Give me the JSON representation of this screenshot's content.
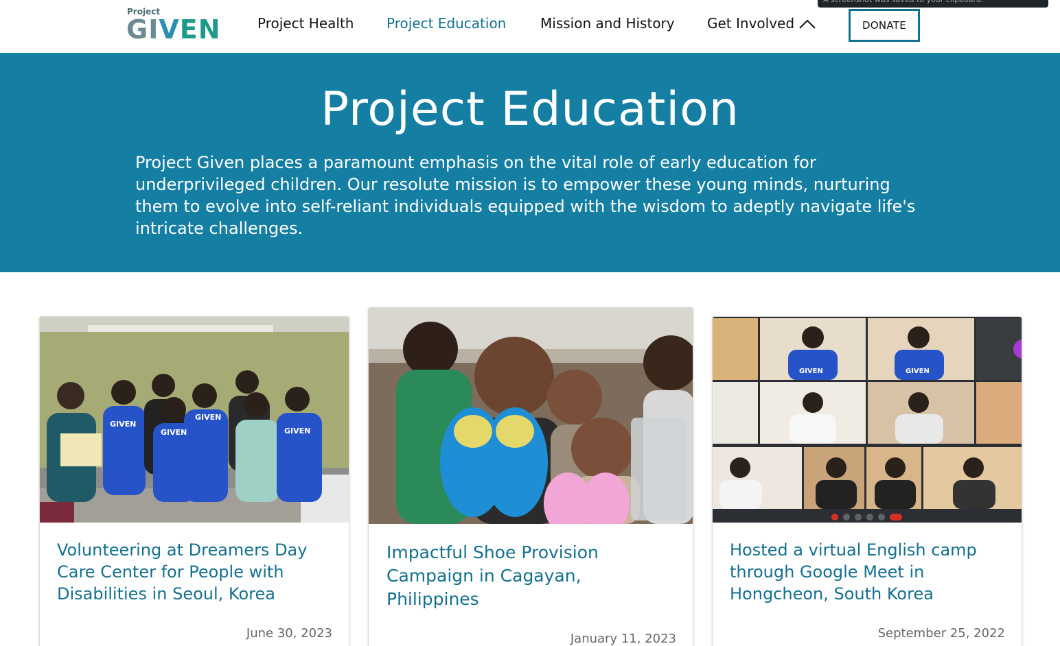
{
  "toast": {
    "text": "A screenshot was saved to your clipboard."
  },
  "logo": {
    "small": "Project",
    "big_a": "GI",
    "big_b": "V",
    "big_c": "EN"
  },
  "nav": {
    "items": [
      "Project Health",
      "Project Education",
      "Mission and History",
      "Get Involved"
    ],
    "active": "Project Education",
    "donate": "DONATE"
  },
  "hero": {
    "title": "Project Education",
    "text": "Project Given places a paramount emphasis on the vital role of early education for underprivileged children. Our resolute mission is to empower these young minds, nurturing them to evolve into self-reliant individuals equipped with the wisdom to adeptly navigate life's intricate challenges."
  },
  "cards": [
    {
      "title": "Volunteering at Dreamers Day Care Center for People with Disabilities in Seoul, Korea",
      "date": "June 30, 2023"
    },
    {
      "title": "Impactful Shoe Provision Campaign in Cagayan, Philippines",
      "date": "January 11, 2023"
    },
    {
      "title": "Hosted a virtual English camp through Google Meet in Hongcheon, South Korea",
      "date": "September 25, 2022"
    }
  ],
  "colors": {
    "brand": "#147ea3",
    "link": "#13708f",
    "shirt": "#2753c9"
  }
}
